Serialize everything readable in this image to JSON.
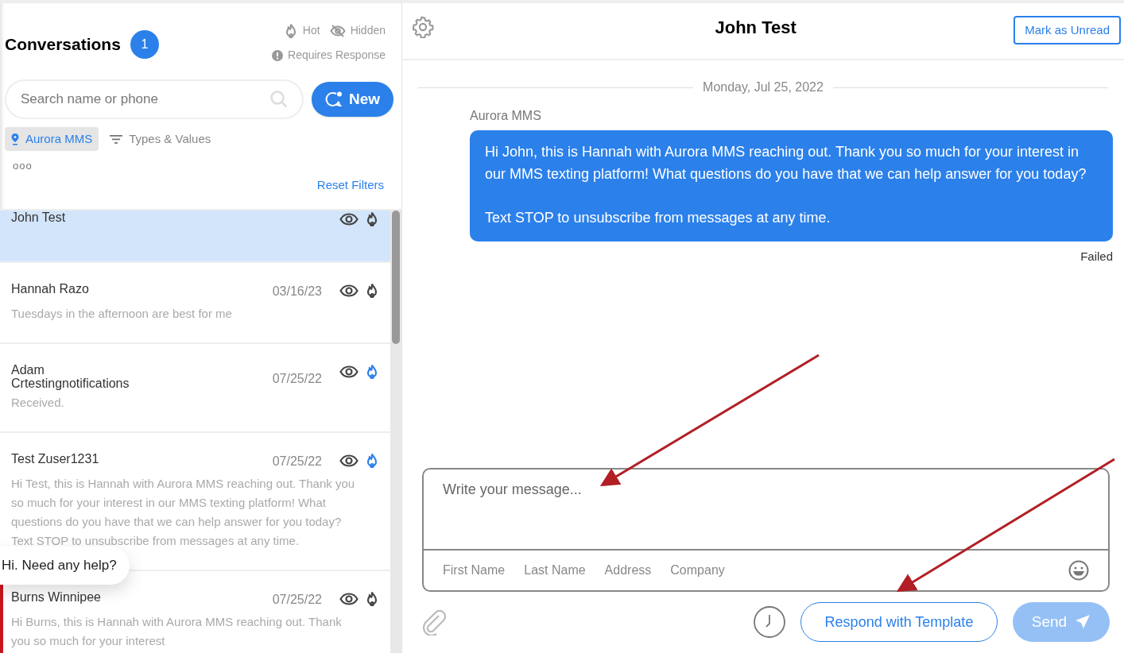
{
  "sidebar": {
    "title": "Conversations",
    "count": "1",
    "legend": [
      {
        "kind": "hot",
        "label": "Hot"
      },
      {
        "kind": "hidden",
        "label": "Hidden"
      },
      {
        "kind": "requires",
        "label": "Requires Response"
      }
    ],
    "search": {
      "placeholder": "Search name or phone"
    },
    "new_button": "New",
    "filters": [
      {
        "kind": "location",
        "label": "Aurora MMS",
        "selected": true
      },
      {
        "kind": "types",
        "label": "Types & Values",
        "selected": false
      }
    ],
    "more": "ooo",
    "reset": "Reset Filters",
    "conversations": [
      {
        "name": "John Test",
        "hot": false,
        "flagged": false,
        "selected": true
      },
      {
        "name": "Hannah Razo",
        "date": "03/16/23",
        "preview": "Tuesdays in the afternoon are best for me",
        "hot": false,
        "flagged": false,
        "selected": false
      },
      {
        "name": "Adam Crtestingnotifications",
        "date": "07/25/22",
        "preview": "Received.",
        "hot": true,
        "flagged": false,
        "selected": false
      },
      {
        "name": "Test Zuser1231",
        "date": "07/25/22",
        "preview": "Hi Test, this is Hannah with Aurora MMS reaching out. Thank you so much for your interest in our MMS texting platform! What questions do you have that we can help answer for you today? Text STOP to unsubscribe from messages at any time.",
        "hot": true,
        "flagged": false,
        "selected": false
      },
      {
        "name": "Burns Winnipee",
        "date": "07/25/22",
        "preview": "Hi Burns, this is Hannah with Aurora MMS reaching out. Thank you so much for your interest",
        "hot": false,
        "flagged": true,
        "selected": false
      }
    ]
  },
  "help_bubble": "Hi. Need any help?",
  "chat": {
    "title": "John Test",
    "mark_unread": "Mark as Unread",
    "date_divider": "Monday, Jul 25, 2022",
    "messages": [
      {
        "sender": "Aurora MMS",
        "text": "Hi John, this is Hannah with Aurora MMS reaching out. Thank you so much for your interest in our MMS texting platform! What questions do you have that we can help answer for you today?\n\nText STOP to unsubscribe from messages at any time.",
        "status": "Failed"
      }
    ],
    "composer": {
      "placeholder": "Write your message...",
      "merge_fields": [
        "First Name",
        "Last Name",
        "Address",
        "Company"
      ],
      "template_button": "Respond with Template",
      "send_button": "Send",
      "send_disabled": true
    }
  }
}
